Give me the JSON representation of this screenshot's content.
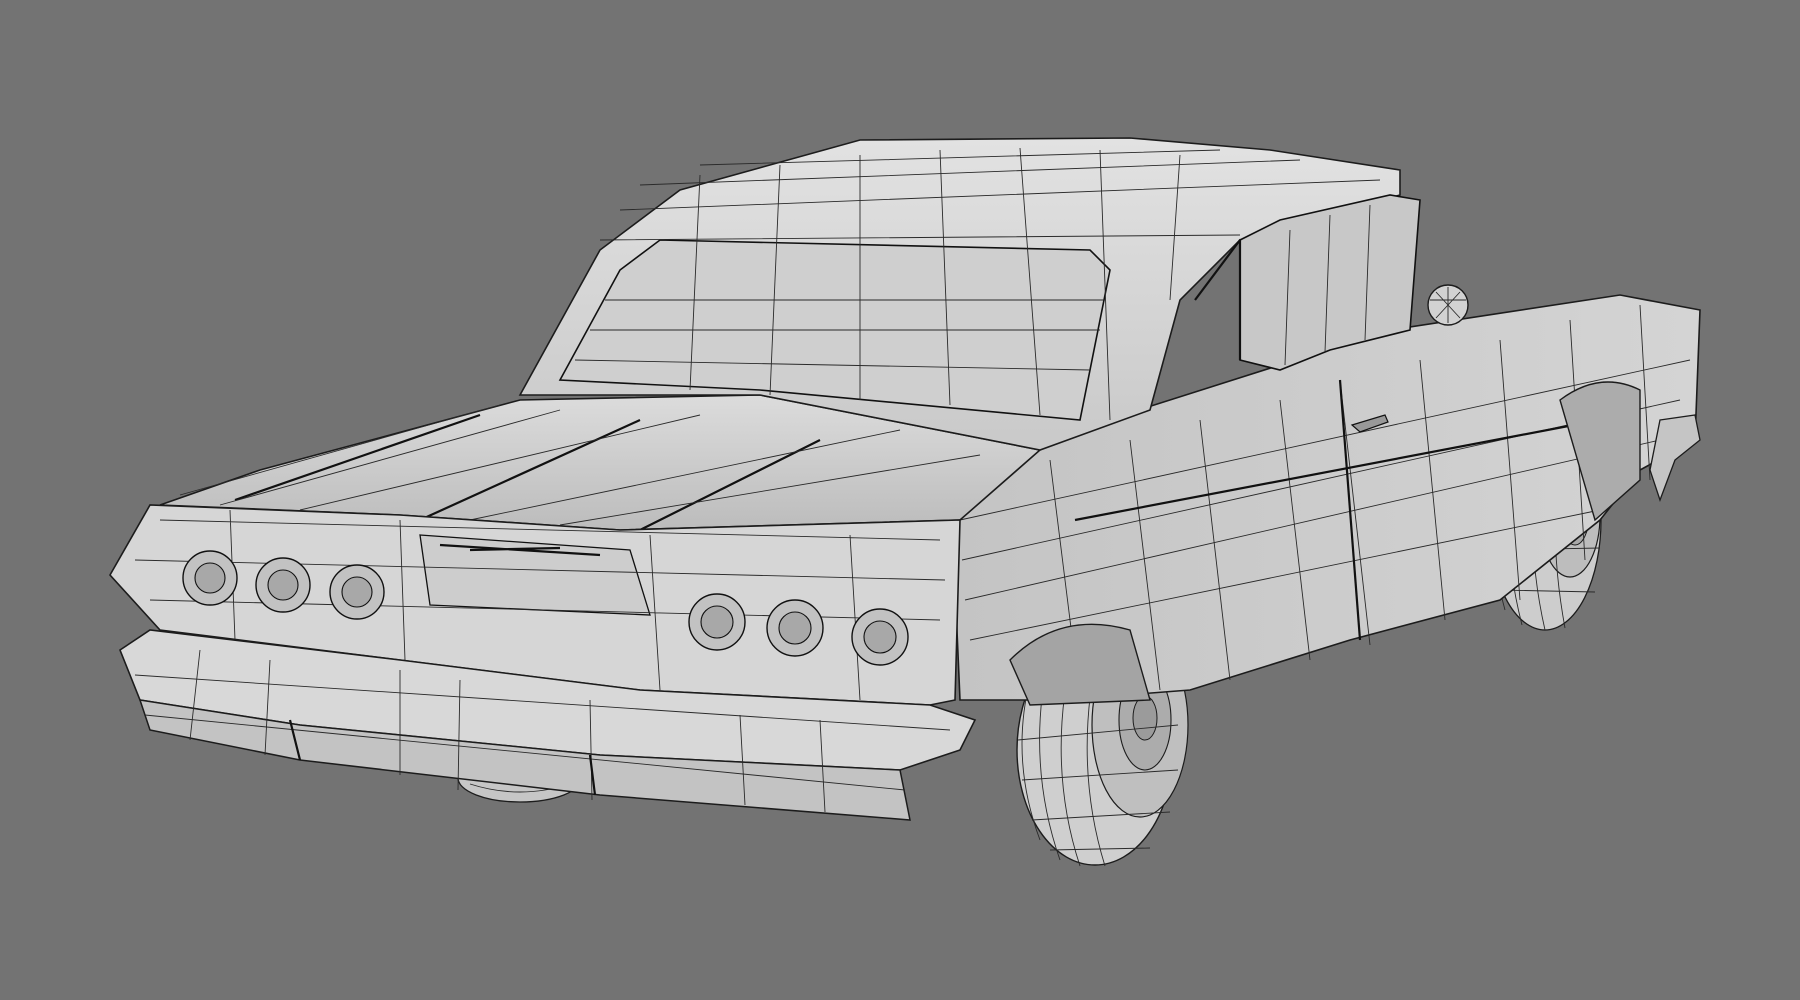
{
  "scene": {
    "background_color": "#737373",
    "surface_color": "#d2d2d2",
    "surface_shade_color": "#bdbdbd",
    "wire_color": "#1c1c1c",
    "subject": "wireframe-car-render"
  }
}
